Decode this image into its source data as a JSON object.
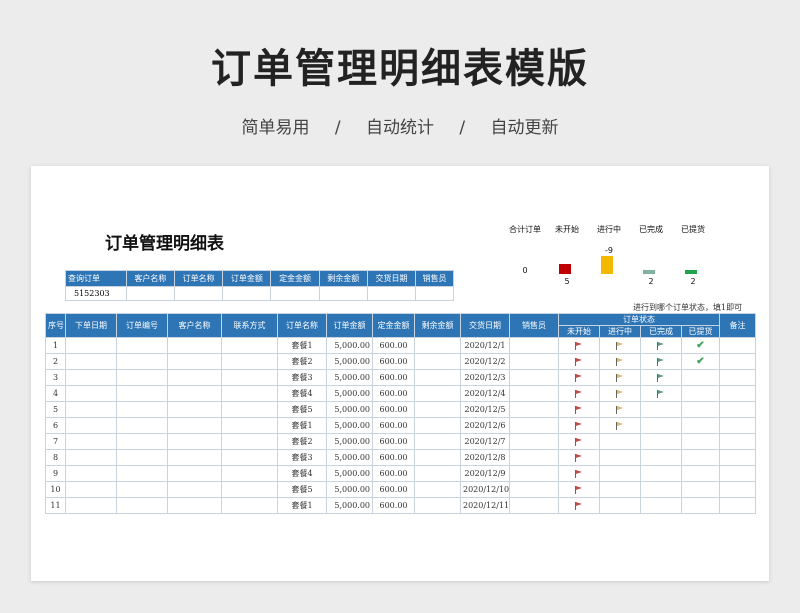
{
  "header": {
    "title": "订单管理明细表模版",
    "tags": [
      "简单易用",
      "自动统计",
      "自动更新"
    ],
    "separator": "/"
  },
  "sheet": {
    "title": "订单管理明细表",
    "query": {
      "headers": [
        "查询订单",
        "客户名称",
        "订单名称",
        "订单金额",
        "定金金额",
        "剩余金额",
        "交货日期",
        "销售员"
      ],
      "values": [
        "5152303",
        "",
        "",
        "",
        "",
        "",
        "",
        ""
      ]
    },
    "stats": {
      "labels": [
        "合计订单",
        "未开始",
        "进行中",
        "已完成",
        "已提货"
      ],
      "values": [
        "0",
        "5",
        "-9",
        "2",
        "2"
      ],
      "counts": [
        0,
        5,
        9,
        2,
        2
      ],
      "colors": [
        "#000000",
        "#c00000",
        "#f5b800",
        "#7fb2a3",
        "#1ea44c"
      ]
    },
    "note": "进行到哪个订单状态，填1即可",
    "table": {
      "headers": [
        "序号",
        "下单日期",
        "订单编号",
        "客户名称",
        "联系方式",
        "订单名称",
        "订单金额",
        "定金金额",
        "剩余金额",
        "交货日期",
        "销售员",
        "订单状态",
        "备注"
      ],
      "status_headers": [
        "未开始",
        "进行中",
        "已完成",
        "已提货"
      ],
      "rows": [
        {
          "no": "1",
          "name": "套餐1",
          "amount": "5,000.00",
          "deposit": "600.00",
          "date": "2020/12/1",
          "status": [
            1,
            1,
            1,
            1
          ]
        },
        {
          "no": "2",
          "name": "套餐2",
          "amount": "5,000.00",
          "deposit": "600.00",
          "date": "2020/12/2",
          "status": [
            1,
            1,
            1,
            1
          ]
        },
        {
          "no": "3",
          "name": "套餐3",
          "amount": "5,000.00",
          "deposit": "600.00",
          "date": "2020/12/3",
          "status": [
            1,
            1,
            1,
            0
          ]
        },
        {
          "no": "4",
          "name": "套餐4",
          "amount": "5,000.00",
          "deposit": "600.00",
          "date": "2020/12/4",
          "status": [
            1,
            1,
            1,
            0
          ]
        },
        {
          "no": "5",
          "name": "套餐5",
          "amount": "5,000.00",
          "deposit": "600.00",
          "date": "2020/12/5",
          "status": [
            1,
            1,
            0,
            0
          ]
        },
        {
          "no": "6",
          "name": "套餐1",
          "amount": "5,000.00",
          "deposit": "600.00",
          "date": "2020/12/6",
          "status": [
            1,
            1,
            0,
            0
          ]
        },
        {
          "no": "7",
          "name": "套餐2",
          "amount": "5,000.00",
          "deposit": "600.00",
          "date": "2020/12/7",
          "status": [
            1,
            0,
            0,
            0
          ]
        },
        {
          "no": "8",
          "name": "套餐3",
          "amount": "5,000.00",
          "deposit": "600.00",
          "date": "2020/12/8",
          "status": [
            1,
            0,
            0,
            0
          ]
        },
        {
          "no": "9",
          "name": "套餐4",
          "amount": "5,000.00",
          "deposit": "600.00",
          "date": "2020/12/9",
          "status": [
            1,
            0,
            0,
            0
          ]
        },
        {
          "no": "10",
          "name": "套餐5",
          "amount": "5,000.00",
          "deposit": "600.00",
          "date": "2020/12/10",
          "status": [
            1,
            0,
            0,
            0
          ]
        },
        {
          "no": "11",
          "name": "套餐1",
          "amount": "5,000.00",
          "deposit": "600.00",
          "date": "2020/12/11",
          "status": [
            1,
            0,
            0,
            0
          ]
        }
      ],
      "status_icons": [
        "red-flag-icon",
        "yellow-flag-icon",
        "green-flag-icon",
        "check-icon"
      ],
      "flag_colors": [
        "#c0504d",
        "#d9b36a",
        "#5e9c8a",
        "#3aa35b"
      ]
    }
  }
}
